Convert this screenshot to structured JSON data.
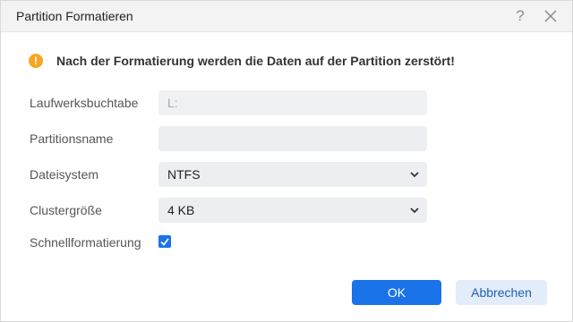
{
  "dialog": {
    "title": "Partition Formatieren",
    "help_icon": "question-icon",
    "close_icon": "close-icon"
  },
  "warning": {
    "icon": "warning-icon",
    "icon_glyph": "!",
    "text": "Nach der Formatierung werden die Daten auf der Partition zerstört!",
    "color": "#f5a623"
  },
  "form": {
    "drive_letter": {
      "label": "Laufwerksbuchtabe",
      "value": "L:",
      "disabled": true
    },
    "partition_name": {
      "label": "Partitionsname",
      "value": ""
    },
    "filesystem": {
      "label": "Dateisystem",
      "value": "NTFS"
    },
    "cluster_size": {
      "label": "Clustergröße",
      "value": "4 KB"
    },
    "quick_format": {
      "label": "Schnellformatierung",
      "checked": true
    }
  },
  "buttons": {
    "ok_label": "OK",
    "cancel_label": "Abbrechen"
  },
  "colors": {
    "accent": "#1a73e8",
    "secondary_button_bg": "#e3edfa",
    "field_bg": "#eceef1"
  }
}
